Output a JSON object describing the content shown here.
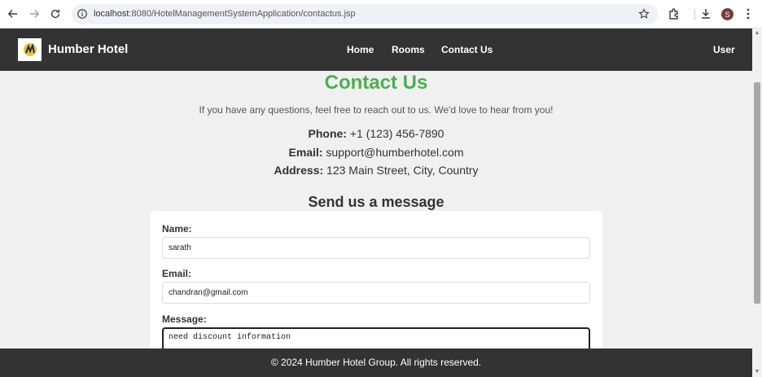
{
  "browser": {
    "url_host": "localhost",
    "url_path": ":8080/HotelManagementSystemApplication/contactus.jsp",
    "profile_initial": "S"
  },
  "header": {
    "brand": "Humber Hotel",
    "nav": [
      "Home",
      "Rooms",
      "Contact Us"
    ],
    "user_link": "User"
  },
  "main": {
    "title": "Contact Us",
    "intro": "If you have any questions, feel free to reach out to us. We'd love to hear from you!",
    "phone_label": "Phone:",
    "phone_value": "+1 (123) 456-7890",
    "email_label": "Email:",
    "email_value": "support@humberhotel.com",
    "address_label": "Address:",
    "address_value": "123 Main Street, City, Country",
    "form_title": "Send us a message"
  },
  "form": {
    "name_label": "Name:",
    "name_value": "sarath",
    "email_label": "Email:",
    "email_value": "chandran@gmail.com",
    "message_label": "Message:",
    "message_value": "need discount information"
  },
  "footer": {
    "text": "© 2024 Humber Hotel Group. All rights reserved."
  },
  "colors": {
    "accent_green": "#4caf50",
    "header_bg": "#333333"
  }
}
